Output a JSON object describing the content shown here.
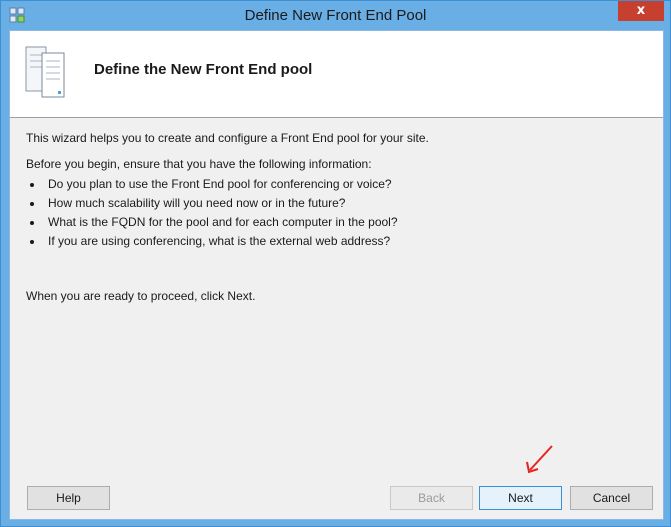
{
  "window": {
    "title": "Define New Front End Pool",
    "close_label": "x"
  },
  "header": {
    "title": "Define the New Front End pool",
    "icon": "server-stack-icon"
  },
  "content": {
    "intro": "This wizard helps you to create and configure a Front End pool for your site.",
    "before_you_begin": "Before you begin, ensure that you have the following information:",
    "bullets": [
      "Do you plan to use the Front End pool for conferencing or voice?",
      "How much scalability will you need now or in the future?",
      "What is the FQDN for the pool and for each computer in the pool?",
      "If you are using conferencing, what is the external web address?"
    ],
    "ready": "When you are ready to proceed, click Next."
  },
  "buttons": {
    "help": "Help",
    "back": "Back",
    "next": "Next",
    "cancel": "Cancel"
  },
  "colors": {
    "titlebar": "#6aaee6",
    "close": "#c7402f",
    "annotation_arrow": "#e8241c"
  }
}
